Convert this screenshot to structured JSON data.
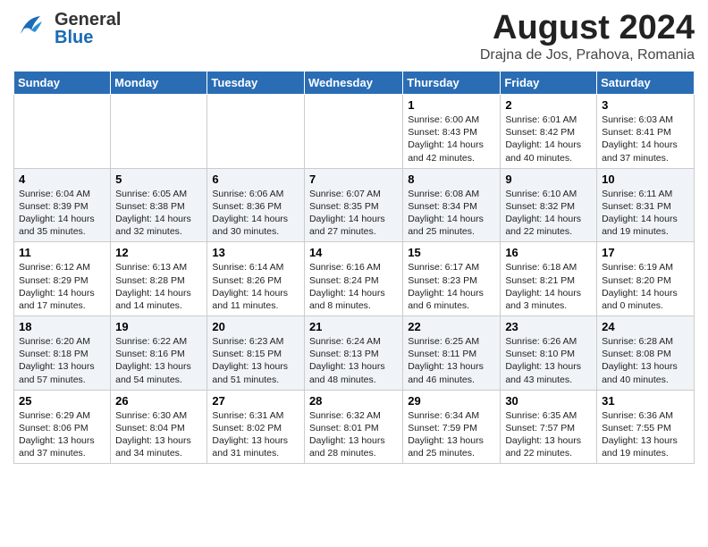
{
  "header": {
    "logo_general": "General",
    "logo_blue": "Blue",
    "month_year": "August 2024",
    "location": "Drajna de Jos, Prahova, Romania"
  },
  "weekdays": [
    "Sunday",
    "Monday",
    "Tuesday",
    "Wednesday",
    "Thursday",
    "Friday",
    "Saturday"
  ],
  "weeks": [
    [
      {
        "day": "",
        "detail": ""
      },
      {
        "day": "",
        "detail": ""
      },
      {
        "day": "",
        "detail": ""
      },
      {
        "day": "",
        "detail": ""
      },
      {
        "day": "1",
        "detail": "Sunrise: 6:00 AM\nSunset: 8:43 PM\nDaylight: 14 hours\nand 42 minutes."
      },
      {
        "day": "2",
        "detail": "Sunrise: 6:01 AM\nSunset: 8:42 PM\nDaylight: 14 hours\nand 40 minutes."
      },
      {
        "day": "3",
        "detail": "Sunrise: 6:03 AM\nSunset: 8:41 PM\nDaylight: 14 hours\nand 37 minutes."
      }
    ],
    [
      {
        "day": "4",
        "detail": "Sunrise: 6:04 AM\nSunset: 8:39 PM\nDaylight: 14 hours\nand 35 minutes."
      },
      {
        "day": "5",
        "detail": "Sunrise: 6:05 AM\nSunset: 8:38 PM\nDaylight: 14 hours\nand 32 minutes."
      },
      {
        "day": "6",
        "detail": "Sunrise: 6:06 AM\nSunset: 8:36 PM\nDaylight: 14 hours\nand 30 minutes."
      },
      {
        "day": "7",
        "detail": "Sunrise: 6:07 AM\nSunset: 8:35 PM\nDaylight: 14 hours\nand 27 minutes."
      },
      {
        "day": "8",
        "detail": "Sunrise: 6:08 AM\nSunset: 8:34 PM\nDaylight: 14 hours\nand 25 minutes."
      },
      {
        "day": "9",
        "detail": "Sunrise: 6:10 AM\nSunset: 8:32 PM\nDaylight: 14 hours\nand 22 minutes."
      },
      {
        "day": "10",
        "detail": "Sunrise: 6:11 AM\nSunset: 8:31 PM\nDaylight: 14 hours\nand 19 minutes."
      }
    ],
    [
      {
        "day": "11",
        "detail": "Sunrise: 6:12 AM\nSunset: 8:29 PM\nDaylight: 14 hours\nand 17 minutes."
      },
      {
        "day": "12",
        "detail": "Sunrise: 6:13 AM\nSunset: 8:28 PM\nDaylight: 14 hours\nand 14 minutes."
      },
      {
        "day": "13",
        "detail": "Sunrise: 6:14 AM\nSunset: 8:26 PM\nDaylight: 14 hours\nand 11 minutes."
      },
      {
        "day": "14",
        "detail": "Sunrise: 6:16 AM\nSunset: 8:24 PM\nDaylight: 14 hours\nand 8 minutes."
      },
      {
        "day": "15",
        "detail": "Sunrise: 6:17 AM\nSunset: 8:23 PM\nDaylight: 14 hours\nand 6 minutes."
      },
      {
        "day": "16",
        "detail": "Sunrise: 6:18 AM\nSunset: 8:21 PM\nDaylight: 14 hours\nand 3 minutes."
      },
      {
        "day": "17",
        "detail": "Sunrise: 6:19 AM\nSunset: 8:20 PM\nDaylight: 14 hours\nand 0 minutes."
      }
    ],
    [
      {
        "day": "18",
        "detail": "Sunrise: 6:20 AM\nSunset: 8:18 PM\nDaylight: 13 hours\nand 57 minutes."
      },
      {
        "day": "19",
        "detail": "Sunrise: 6:22 AM\nSunset: 8:16 PM\nDaylight: 13 hours\nand 54 minutes."
      },
      {
        "day": "20",
        "detail": "Sunrise: 6:23 AM\nSunset: 8:15 PM\nDaylight: 13 hours\nand 51 minutes."
      },
      {
        "day": "21",
        "detail": "Sunrise: 6:24 AM\nSunset: 8:13 PM\nDaylight: 13 hours\nand 48 minutes."
      },
      {
        "day": "22",
        "detail": "Sunrise: 6:25 AM\nSunset: 8:11 PM\nDaylight: 13 hours\nand 46 minutes."
      },
      {
        "day": "23",
        "detail": "Sunrise: 6:26 AM\nSunset: 8:10 PM\nDaylight: 13 hours\nand 43 minutes."
      },
      {
        "day": "24",
        "detail": "Sunrise: 6:28 AM\nSunset: 8:08 PM\nDaylight: 13 hours\nand 40 minutes."
      }
    ],
    [
      {
        "day": "25",
        "detail": "Sunrise: 6:29 AM\nSunset: 8:06 PM\nDaylight: 13 hours\nand 37 minutes."
      },
      {
        "day": "26",
        "detail": "Sunrise: 6:30 AM\nSunset: 8:04 PM\nDaylight: 13 hours\nand 34 minutes."
      },
      {
        "day": "27",
        "detail": "Sunrise: 6:31 AM\nSunset: 8:02 PM\nDaylight: 13 hours\nand 31 minutes."
      },
      {
        "day": "28",
        "detail": "Sunrise: 6:32 AM\nSunset: 8:01 PM\nDaylight: 13 hours\nand 28 minutes."
      },
      {
        "day": "29",
        "detail": "Sunrise: 6:34 AM\nSunset: 7:59 PM\nDaylight: 13 hours\nand 25 minutes."
      },
      {
        "day": "30",
        "detail": "Sunrise: 6:35 AM\nSunset: 7:57 PM\nDaylight: 13 hours\nand 22 minutes."
      },
      {
        "day": "31",
        "detail": "Sunrise: 6:36 AM\nSunset: 7:55 PM\nDaylight: 13 hours\nand 19 minutes."
      }
    ]
  ]
}
